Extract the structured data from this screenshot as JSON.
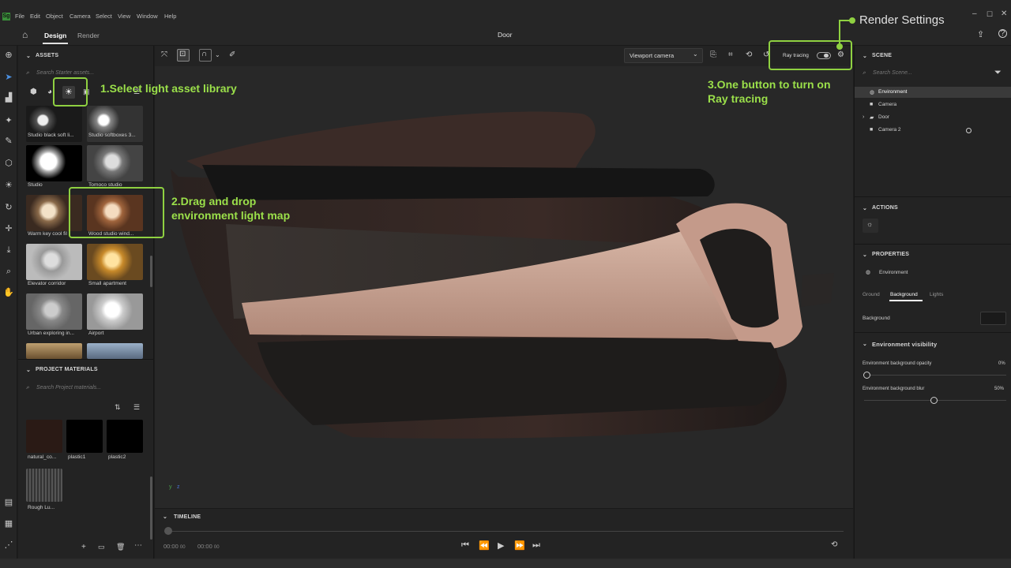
{
  "menu": [
    "File",
    "Edit",
    "Object",
    "Camera",
    "Select",
    "View",
    "Window",
    "Help"
  ],
  "logo": "Sg",
  "tabs": {
    "design": "Design",
    "render": "Render"
  },
  "document_title": "Door",
  "assets": {
    "header": "ASSETS",
    "search_placeholder": "Search Starter assets...",
    "items": [
      {
        "label": "Studio black soft li..."
      },
      {
        "label": "Studio softboxes 3..."
      },
      {
        "label": "Studio"
      },
      {
        "label": "Tomoco studio"
      },
      {
        "label": "Warm key cool fil"
      },
      {
        "label": "Wood studio wind..."
      },
      {
        "label": "Elevator corridor"
      },
      {
        "label": "Small apartment"
      },
      {
        "label": "Urban exploring in..."
      },
      {
        "label": "Airport"
      }
    ]
  },
  "project_materials": {
    "header": "PROJECT MATERIALS",
    "search_placeholder": "Search Project materials...",
    "items": [
      "natural_co...",
      "plastic1",
      "plastic2",
      "Rough Lu..."
    ]
  },
  "viewport": {
    "camera_dropdown": "Viewport camera",
    "ray_tracing_label": "Ray tracing"
  },
  "timeline": {
    "header": "TIMELINE",
    "time_start": "00:00",
    "time_start_frac": "00",
    "time_end": "00:00",
    "time_end_frac": "00"
  },
  "scene": {
    "header": "SCENE",
    "search_placeholder": "Search Scene...",
    "items": [
      "Environment",
      "Camera",
      "Door",
      "Camera 2"
    ]
  },
  "actions": {
    "header": "ACTIONS"
  },
  "properties": {
    "header": "PROPERTIES",
    "object_name": "Environment",
    "tabs": [
      "Ground",
      "Background",
      "Lights"
    ],
    "background_label": "Background",
    "visibility_header": "Environment visibility",
    "opacity_label": "Environment background opacity",
    "opacity_value": "0%",
    "blur_label": "Environment background blur",
    "blur_value": "50%"
  },
  "annotations": {
    "render_settings": "Render Settings",
    "step1": "1.Select light asset library",
    "step2_line1": "2.Drag and drop",
    "step2_line2": "environment light map",
    "step3_line1": "3.One button to turn on",
    "step3_line2": "Ray tracing"
  },
  "colors": {
    "accent_green": "#8fd141",
    "panel": "#232323",
    "viewport": "#282828"
  }
}
